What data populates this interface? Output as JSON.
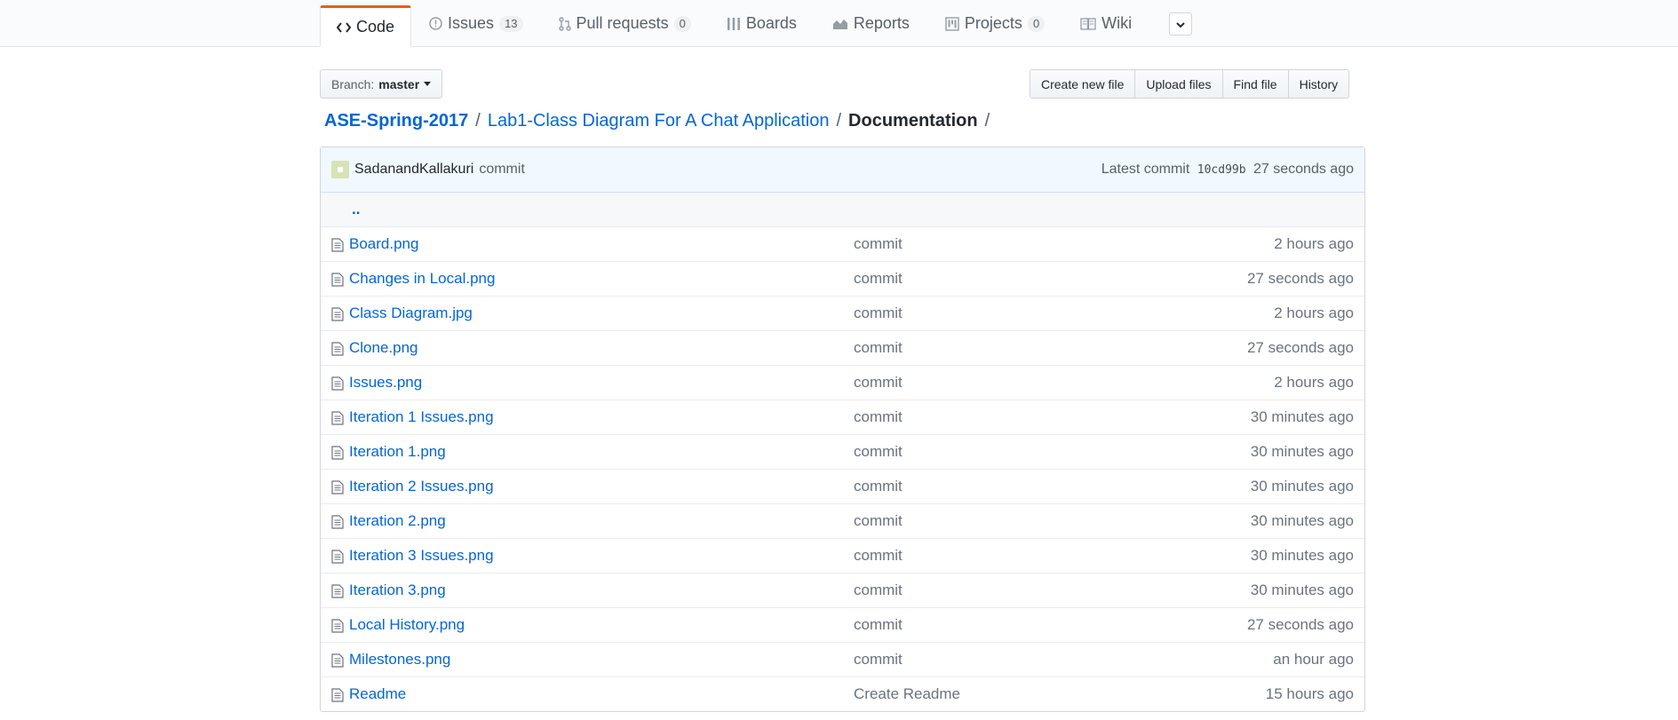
{
  "nav": {
    "tabs": [
      {
        "label": "Code",
        "icon": "code-icon",
        "counter": null
      },
      {
        "label": "Issues",
        "icon": "issue-icon",
        "counter": "13"
      },
      {
        "label": "Pull requests",
        "icon": "pull-request-icon",
        "counter": "0"
      },
      {
        "label": "Boards",
        "icon": "boards-icon",
        "counter": null
      },
      {
        "label": "Reports",
        "icon": "graph-icon",
        "counter": null
      },
      {
        "label": "Projects",
        "icon": "project-icon",
        "counter": "0"
      },
      {
        "label": "Wiki",
        "icon": "book-icon",
        "counter": null
      }
    ]
  },
  "toolbar": {
    "branch_label": "Branch:",
    "branch_name": "master",
    "create_new_file": "Create new file",
    "upload_files": "Upload files",
    "find_file": "Find file",
    "history": "History"
  },
  "breadcrumb": {
    "repo": "ASE-Spring-2017",
    "folder": "Lab1-Class Diagram For A Chat Application",
    "current": "Documentation",
    "separator": "/"
  },
  "commit_tease": {
    "author": "SadanandKallakuri",
    "message": "commit",
    "latest_label": "Latest commit",
    "sha": "10cd99b",
    "age": "27 seconds ago"
  },
  "up_label": "..",
  "files": [
    {
      "name": "Board.png",
      "message": "commit",
      "age": "2 hours ago"
    },
    {
      "name": "Changes in Local.png",
      "message": "commit",
      "age": "27 seconds ago"
    },
    {
      "name": "Class Diagram.jpg",
      "message": "commit",
      "age": "2 hours ago"
    },
    {
      "name": "Clone.png",
      "message": "commit",
      "age": "27 seconds ago"
    },
    {
      "name": "Issues.png",
      "message": "commit",
      "age": "2 hours ago"
    },
    {
      "name": "Iteration 1 Issues.png",
      "message": "commit",
      "age": "30 minutes ago"
    },
    {
      "name": "Iteration 1.png",
      "message": "commit",
      "age": "30 minutes ago"
    },
    {
      "name": "Iteration 2 Issues.png",
      "message": "commit",
      "age": "30 minutes ago"
    },
    {
      "name": "Iteration 2.png",
      "message": "commit",
      "age": "30 minutes ago"
    },
    {
      "name": "Iteration 3 Issues.png",
      "message": "commit",
      "age": "30 minutes ago"
    },
    {
      "name": "Iteration 3.png",
      "message": "commit",
      "age": "30 minutes ago"
    },
    {
      "name": "Local History.png",
      "message": "commit",
      "age": "27 seconds ago"
    },
    {
      "name": "Milestones.png",
      "message": "commit",
      "age": "an hour ago"
    },
    {
      "name": "Readme",
      "message": "Create Readme",
      "age": "15 hours ago"
    }
  ],
  "colors": {
    "accent": "#e36209",
    "link": "#0366d6",
    "muted": "#6a737d"
  }
}
